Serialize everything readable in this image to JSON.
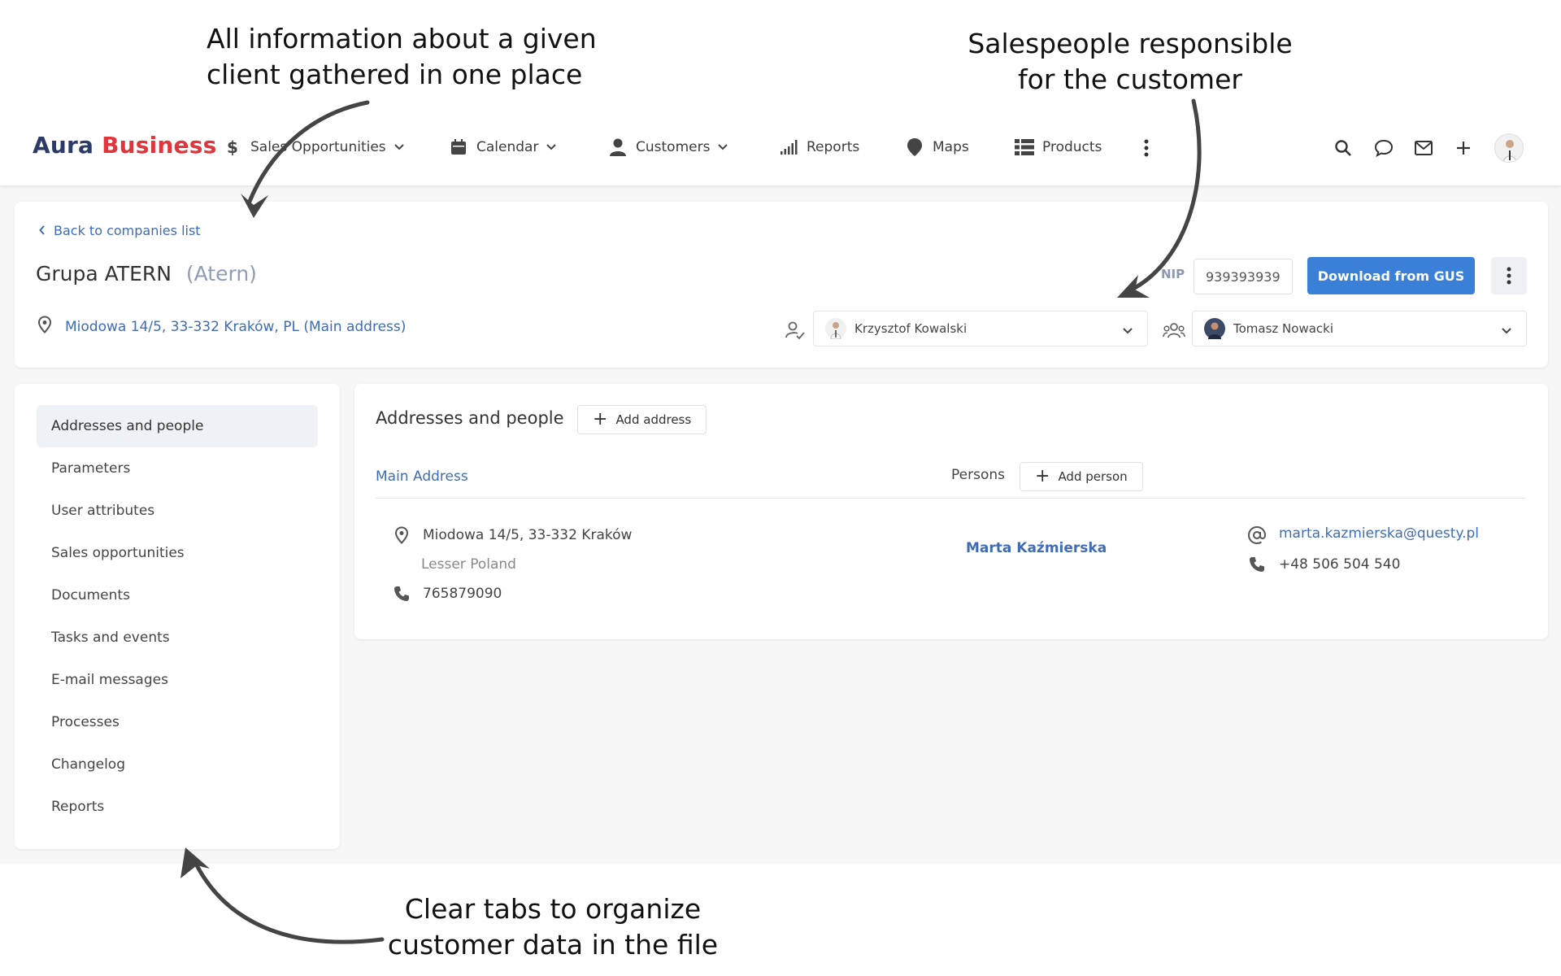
{
  "annotations": {
    "left": [
      "All information about a given",
      "client gathered in one place"
    ],
    "right": [
      "Salespeople responsible",
      "for the customer"
    ],
    "bottom": [
      "Clear tabs to organize",
      "customer data in the file"
    ]
  },
  "logo": {
    "part1": "Aura",
    "part2": "Business"
  },
  "nav": [
    {
      "label": "Sales Opportunities",
      "icon": "dollar-icon",
      "dropdown": true
    },
    {
      "label": "Calendar",
      "icon": "calendar-icon",
      "dropdown": true
    },
    {
      "label": "Customers",
      "icon": "person-icon",
      "dropdown": true
    },
    {
      "label": "Reports",
      "icon": "bar-chart-icon",
      "dropdown": false
    },
    {
      "label": "Maps",
      "icon": "map-pin-icon",
      "dropdown": false
    },
    {
      "label": "Products",
      "icon": "list-icon",
      "dropdown": false
    }
  ],
  "header": {
    "back_label": "Back to companies list",
    "company_name": "Grupa ATERN",
    "company_alias": "(Atern)",
    "address": "Miodowa 14/5, 33-332 Kraków, PL (Main address)",
    "nip_label": "NIP",
    "nip_value": "939393939",
    "gus_button": "Download from GUS",
    "owner": "Krzysztof Kowalski",
    "team_member": "Tomasz Nowacki"
  },
  "tabs": [
    "Addresses and people",
    "Parameters",
    "User attributes",
    "Sales opportunities",
    "Documents",
    "Tasks and events",
    "E-mail messages",
    "Processes",
    "Changelog",
    "Reports"
  ],
  "active_tab": "Addresses and people",
  "main": {
    "title": "Addresses and people",
    "add_address": "Add address",
    "main_address_label": "Main Address",
    "persons_label": "Persons",
    "add_person": "Add person",
    "address_line": "Miodowa 14/5, 33-332 Kraków",
    "region": "Lesser Poland",
    "address_phone": "765879090",
    "person_name": "Marta Kaźmierska",
    "person_email": "marta.kazmierska@questy.pl",
    "person_phone": "+48 506 504 540"
  },
  "colors": {
    "brand_dark": "#2b3a67",
    "brand_red": "#e0353b",
    "link_blue": "#3f6cb5",
    "primary_button": "#3a80d9"
  }
}
